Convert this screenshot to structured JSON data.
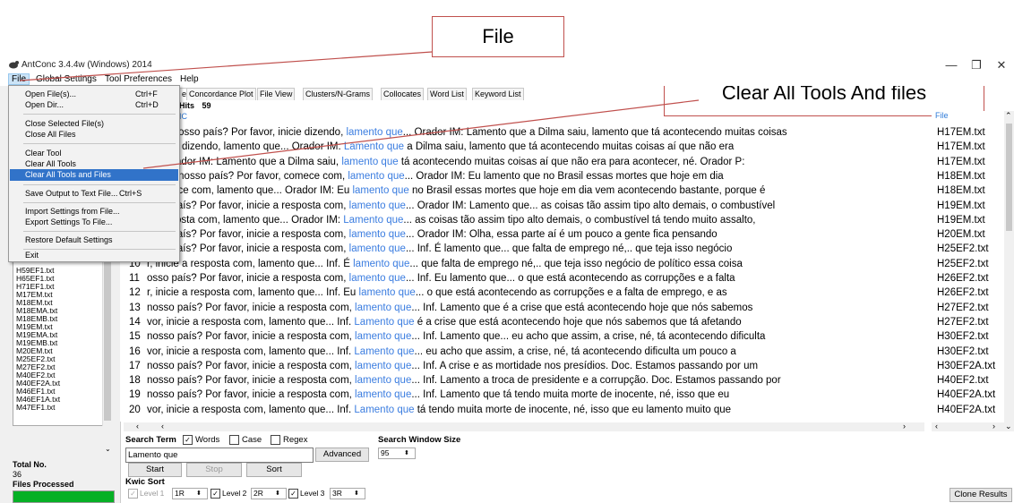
{
  "callouts": {
    "file": "File",
    "clear": "Clear All Tools And files"
  },
  "window": {
    "title": "AntConc 3.4.4w (Windows) 2014",
    "minimize": "—",
    "restore": "❐",
    "close": "✕"
  },
  "menubar": [
    "File",
    "Global Settings",
    "Tool Preferences",
    "Help"
  ],
  "file_menu": [
    {
      "label": "Open File(s)...",
      "shortcut": "Ctrl+F"
    },
    {
      "label": "Open Dir...",
      "shortcut": "Ctrl+D"
    },
    {
      "label": "Close Selected File(s)",
      "shortcut": ""
    },
    {
      "label": "Close All Files",
      "shortcut": ""
    },
    {
      "label": "Clear Tool",
      "shortcut": ""
    },
    {
      "label": "Clear All Tools",
      "shortcut": ""
    },
    {
      "label": "Clear All Tools and Files",
      "shortcut": ""
    },
    {
      "label": "Save Output to Text File...",
      "shortcut": "Ctrl+S"
    },
    {
      "label": "Import Settings from File...",
      "shortcut": ""
    },
    {
      "label": "Export Settings To File...",
      "shortcut": ""
    },
    {
      "label": "Restore Default Settings",
      "shortcut": ""
    },
    {
      "label": "Exit",
      "shortcut": ""
    }
  ],
  "tabs": [
    "e",
    "Concordance Plot",
    "File View",
    "Clusters/N-Grams",
    "Collocates",
    "Word List",
    "Keyword List"
  ],
  "hits": {
    "label": "Hits",
    "value": "59"
  },
  "kwic_header": "IC",
  "file_header": "File",
  "rows": [
    {
      "num": "",
      "left": "o em nosso país? Por favor, inicie dizendo, ",
      "hit": "lamento que",
      "right": "... Orador IM: Lamento que a Dilma saiu, lamento que tá acontecendo muitas coisas",
      "file": "H17EM.txt"
    },
    {
      "num": "",
      "left": "r, inicie dizendo, lamento que... Orador IM: ",
      "hit": "Lamento que",
      "right": " a Dilma saiu, lamento que tá acontecendo muitas coisas aí que não era",
      "file": "H17EM.txt"
    },
    {
      "num": "",
      "left": "e... Orador IM: Lamento que a Dilma saiu, ",
      "hit": "lamento que",
      "right": " tá acontecendo muitas coisas aí que não era para acontecer, né. Orador P:",
      "file": "H17EM.txt"
    },
    {
      "num": "",
      "left": "do em nosso país? Por favor, comece com, ",
      "hit": "lamento que",
      "right": "... Orador IM: Eu lamento que no Brasil essas mortes que hoje em dia",
      "file": "H18EM.txt"
    },
    {
      "num": "",
      "left": ", comece com, lamento que... Orador IM: Eu ",
      "hit": "lamento que",
      "right": " no Brasil essas mortes que hoje em dia vem acontecendo bastante, porque é",
      "file": "H18EM.txt"
    },
    {
      "num": "",
      "left": "osso país? Por favor, inicie a resposta com, ",
      "hit": "lamento que",
      "right": "... Orador IM: Lamento que... as coisas tão assim tipo alto demais, o combustível",
      "file": "H19EM.txt"
    },
    {
      "num": "",
      "left": "a resposta com, lamento que... Orador IM: ",
      "hit": "Lamento que",
      "right": "... as coisas tão assim tipo alto demais, o combustível tá tendo muito assalto,",
      "file": "H19EM.txt"
    },
    {
      "num": "",
      "left": "osso país? Por favor, inicie a resposta com, ",
      "hit": "lamento que",
      "right": "... Orador IM: Olha, essa parte aí é um pouco a gente fica pensando",
      "file": "H20EM.txt"
    },
    {
      "num": "",
      "left": "osso país? Por favor, inicie a resposta com, ",
      "hit": "lamento que",
      "right": "... Inf. É lamento que... que falta de emprego né,.. que teja isso negócio",
      "file": "H25EF2.txt"
    },
    {
      "num": "10",
      "left": "r, inicie a resposta com, lamento que... Inf. É ",
      "hit": "lamento que",
      "right": "... que falta de emprego né,.. que teja isso negócio de político essa coisa",
      "file": "H25EF2.txt"
    },
    {
      "num": "11",
      "left": "osso país? Por favor, inicie a resposta com, ",
      "hit": "lamento que",
      "right": "... Inf. Eu lamento que... o que está acontecendo as corrupções e a falta",
      "file": "H26EF2.txt"
    },
    {
      "num": "12",
      "left": "r, inicie a resposta com, lamento que... Inf. Eu ",
      "hit": "lamento que",
      "right": "... o que está acontecendo as corrupções e a falta de emprego, e as",
      "file": "H26EF2.txt"
    },
    {
      "num": "13",
      "left": "nosso país? Por favor, inicie a resposta com, ",
      "hit": "lamento que",
      "right": "... Inf. Lamento que é a crise que está acontecendo hoje que nós sabemos",
      "file": "H27EF2.txt"
    },
    {
      "num": "14",
      "left": "vor, inicie a resposta com, lamento que... Inf. ",
      "hit": "Lamento que",
      "right": " é a crise que está acontecendo hoje que nós sabemos que tá afetando",
      "file": "H27EF2.txt"
    },
    {
      "num": "15",
      "left": "nosso país? Por favor, inicie a resposta com, ",
      "hit": "lamento que",
      "right": "... Inf. Lamento que... eu acho que assim, a crise, né, tá acontecendo dificulta",
      "file": "H30EF2.txt"
    },
    {
      "num": "16",
      "left": "vor, inicie a resposta com, lamento que... Inf. ",
      "hit": "Lamento que",
      "right": "... eu acho que assim, a crise, né, tá acontecendo dificulta um pouco a",
      "file": "H30EF2.txt"
    },
    {
      "num": "17",
      "left": "nosso país? Por favor, inicie a resposta com, ",
      "hit": "lamento que",
      "right": "... Inf. A crise e as mortidade nos presídios. Doc. Estamos passando por um",
      "file": "H30EF2A.txt"
    },
    {
      "num": "18",
      "left": "nosso país? Por favor, inicie a resposta com, ",
      "hit": "lamento que",
      "right": "... Inf. Lamento a troca de presidente e a corrupção. Doc. Estamos passando por",
      "file": "H40EF2.txt"
    },
    {
      "num": "19",
      "left": "nosso país? Por favor, inicie a resposta com, ",
      "hit": "lamento que",
      "right": "...  Inf. Lamento que tá tendo muita morte de inocente, né, isso que eu",
      "file": "H40EF2A.txt"
    },
    {
      "num": "20",
      "left": "vor, inicie a resposta com, lamento que... Inf. ",
      "hit": "Lamento que",
      "right": " tá tendo muita morte de inocente, né, isso que eu lamento muito que",
      "file": "H40EF2A.txt"
    }
  ],
  "left_files": [
    "H59EF1.txt",
    "H65EF1.txt",
    "H71EF1.txt",
    "M17EM.txt",
    "M18EM.txt",
    "M18EMA.txt",
    "M18EMB.txt",
    "M19EM.txt",
    "M19EMA.txt",
    "M19EMB.txt",
    "M20EM.txt",
    "M25EF2.txt",
    "M27EF2.txt",
    "M40EF2.txt",
    "M40EF2A.txt",
    "M46EF1.txt",
    "M46EF1A.txt",
    "M47EF1.txt"
  ],
  "left_panel": {
    "total_label": "Total No.",
    "total_value": "36",
    "processed_label": "Files Processed"
  },
  "search": {
    "term_label": "Search Term",
    "words": "Words",
    "case": "Case",
    "regex": "Regex",
    "value": "Lamento que",
    "advanced": "Advanced",
    "window_label": "Search Window Size",
    "window_value": "95",
    "start": "Start",
    "stop": "Stop",
    "sort": "Sort"
  },
  "kwic_sort": {
    "label": "Kwic Sort",
    "level1": "Level 1",
    "level1_val": "1R",
    "level2": "Level 2",
    "level2_val": "2R",
    "level3": "Level 3",
    "level3_val": "3R"
  },
  "clone_results": "Clone Results",
  "colors": {
    "hit": "#3b7de0",
    "menu_highlight": "#3173c9",
    "callout_line": "#c0504d",
    "progress": "#06b025"
  }
}
